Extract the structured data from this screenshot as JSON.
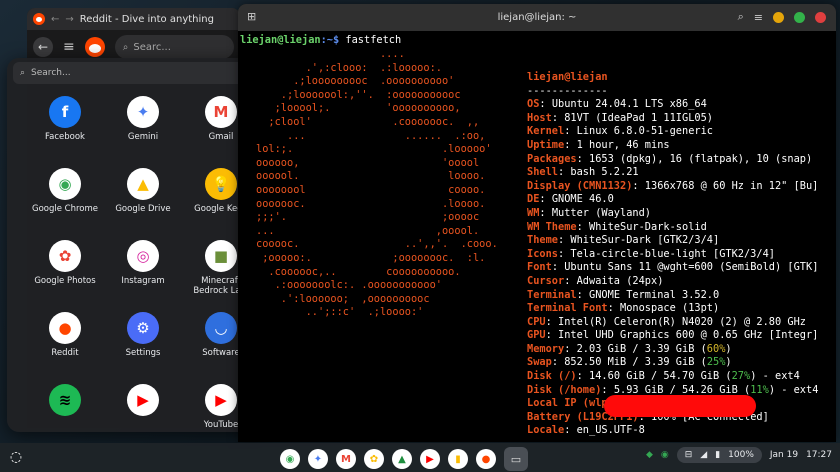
{
  "browser": {
    "tab_title": "Reddit - Dive into anything",
    "search_placeholder": "Searc..."
  },
  "launcher": {
    "search_placeholder": "Search...",
    "apps": [
      {
        "label": "Facebook",
        "icon": "facebook-icon",
        "glyph": "f",
        "bg": "#1877f2",
        "fg": "#ffffff"
      },
      {
        "label": "Gemini",
        "icon": "gemini-icon",
        "glyph": "✦",
        "bg": "#ffffff",
        "fg": "#4a7df0"
      },
      {
        "label": "Gmail",
        "icon": "gmail-icon",
        "glyph": "M",
        "bg": "#ffffff",
        "fg": "#ea4335"
      },
      {
        "label": "Google Chrome",
        "icon": "chrome-icon",
        "glyph": "◉",
        "bg": "#ffffff",
        "fg": "#34a853"
      },
      {
        "label": "Google Drive",
        "icon": "drive-icon",
        "glyph": "▲",
        "bg": "#ffffff",
        "fg": "#fbbc04"
      },
      {
        "label": "Google Keep",
        "icon": "keep-icon",
        "glyph": "💡",
        "bg": "#fbbc04",
        "fg": "#ffffff"
      },
      {
        "label": "Google Photos",
        "icon": "photos-icon",
        "glyph": "✿",
        "bg": "#ffffff",
        "fg": "#ea4335"
      },
      {
        "label": "Instagram",
        "icon": "instagram-icon",
        "glyph": "◎",
        "bg": "#ffffff",
        "fg": "#d6249f"
      },
      {
        "label": "Minecraft Bedrock La...",
        "icon": "minecraft-icon",
        "glyph": "■",
        "bg": "#ffffff",
        "fg": "#6b8f3a"
      },
      {
        "label": "Reddit",
        "icon": "reddit-icon",
        "glyph": "●",
        "bg": "#ffffff",
        "fg": "#ff4500"
      },
      {
        "label": "Settings",
        "icon": "settings-icon",
        "glyph": "⚙",
        "bg": "#4a6cf7",
        "fg": "#ffffff"
      },
      {
        "label": "Software",
        "icon": "software-icon",
        "glyph": "◡",
        "bg": "#2f6fde",
        "fg": "#ffffff"
      },
      {
        "label": "",
        "icon": "spotify-icon",
        "glyph": "≋",
        "bg": "#1db954",
        "fg": "#000000"
      },
      {
        "label": "",
        "icon": "youtube-icon",
        "glyph": "▶",
        "bg": "#ffffff",
        "fg": "#ff0000"
      },
      {
        "label": "YouTube",
        "icon": "youtube-music-icon",
        "glyph": "▶",
        "bg": "#ffffff",
        "fg": "#ff0000"
      }
    ]
  },
  "terminal": {
    "window_title": "liejan@liejan: ~",
    "prompt_user": "liejan@liejan",
    "prompt_path": ":~$ ",
    "command": "fastfetch",
    "ascii_art": "                    ....\n        .',:clooo:  .:looooo:.\n      .;looooooooc  .oooooooooo'\n    .;looooool:,''.  :ooooooooooc\n   ;looool;.         'oooooooooo,\n  ;clool'             .cooooooc.  ,,\n     ...                ......  .:oo,\nlol:;.                        .looooo'\noooooo,                       'ooool\noooool.                        loooo.\noooooool                       coooo.\nooooooc.                      .loooo.\n;;;'.                         ;ooooc\n...                          ,ooool.\ncooooc.                 ..',,'.  .cooo.\n ;ooooo:.             ;oooooooc.  :l.\n  .coooooc,..        coooooooooo.\n   .:ooooooolc:. .ooooooooooo'\n    .':loooooo;  ,oooooooooc\n        ..';::c'  .;loooo:'",
    "info_title": "liejan@liejan",
    "info_sep": "-------------",
    "info": [
      {
        "key": "OS",
        "value": "Ubuntu 24.04.1 LTS x86_64"
      },
      {
        "key": "Host",
        "value": "81VT (IdeaPad 1 11IGL05)"
      },
      {
        "key": "Kernel",
        "value": "Linux 6.8.0-51-generic"
      },
      {
        "key": "Uptime",
        "value": "1 hour, 46 mins"
      },
      {
        "key": "Packages",
        "value": "1653 (dpkg), 16 (flatpak), 10 (snap)"
      },
      {
        "key": "Shell",
        "value": "bash 5.2.21"
      },
      {
        "key": "Display (CMN1132)",
        "value": "1366x768 @ 60 Hz in 12\" [Bu]"
      },
      {
        "key": "DE",
        "value": "GNOME 46.0"
      },
      {
        "key": "WM",
        "value": "Mutter (Wayland)"
      },
      {
        "key": "WM Theme",
        "value": "WhiteSur-Dark-solid"
      },
      {
        "key": "Theme",
        "value": "WhiteSur-Dark [GTK2/3/4]"
      },
      {
        "key": "Icons",
        "value": "Tela-circle-blue-light [GTK2/3/4]"
      },
      {
        "key": "Font",
        "value": "Ubuntu Sans 11 @wght=600 (SemiBold) [GTK]"
      },
      {
        "key": "Cursor",
        "value": "Adwaita (24px)"
      },
      {
        "key": "Terminal",
        "value": "GNOME Terminal 3.52.0"
      },
      {
        "key": "Terminal Font",
        "value": "Monospace (13pt)"
      },
      {
        "key": "CPU",
        "value": "Intel(R) Celeron(R) N4020 (2) @ 2.80 GHz"
      },
      {
        "key": "GPU",
        "value": "Intel UHD Graphics 600 @ 0.65 GHz [Integr]"
      }
    ],
    "memory": {
      "key": "Memory",
      "value": "2.03 GiB / 3.39 GiB (",
      "pct": "60%",
      "tail": ")"
    },
    "swap": {
      "key": "Swap",
      "value": "852.50 MiB / 3.39 GiB (",
      "pct": "25%",
      "tail": ")"
    },
    "disk_root": {
      "key": "Disk (/)",
      "value": "14.60 GiB / 54.70 GiB (",
      "pct": "27%",
      "tail": ") - ext4"
    },
    "disk_home": {
      "key": "Disk (/home)",
      "value": "5.93 GiB / 54.26 GiB (",
      "pct": "11%",
      "tail": ") - ext4"
    },
    "local_ip": {
      "key": "Local IP (wlp2s0)",
      "value": ""
    },
    "battery": {
      "key": "Battery (L19C2PF1)",
      "value": "100% [AC Connected]"
    },
    "locale": {
      "key": "Locale",
      "value": "en_US.UTF-8"
    },
    "palette": [
      "#000000",
      "#cc2222",
      "#26a269",
      "#a2734c",
      "#12488b",
      "#a347ba",
      "#2aa1b3",
      "#d0cfcc"
    ]
  },
  "shelf": {
    "apps": [
      {
        "icon": "chrome-icon",
        "glyph": "◉",
        "fg": "#34a853"
      },
      {
        "icon": "gemini-icon",
        "glyph": "✦",
        "fg": "#4a7df0"
      },
      {
        "icon": "gmail-icon",
        "glyph": "M",
        "fg": "#ea4335"
      },
      {
        "icon": "photos-icon",
        "glyph": "✿",
        "fg": "#fbbc04"
      },
      {
        "icon": "drive-icon",
        "glyph": "▲",
        "fg": "#1e8e3e"
      },
      {
        "icon": "youtube-icon",
        "glyph": "▶",
        "fg": "#ff0000"
      },
      {
        "icon": "keep-icon",
        "glyph": "▮",
        "fg": "#fbbc04"
      },
      {
        "icon": "reddit-icon",
        "glyph": "●",
        "fg": "#ff4500"
      }
    ],
    "date": "Jan 19",
    "time": "17:27",
    "battery": "100%"
  }
}
